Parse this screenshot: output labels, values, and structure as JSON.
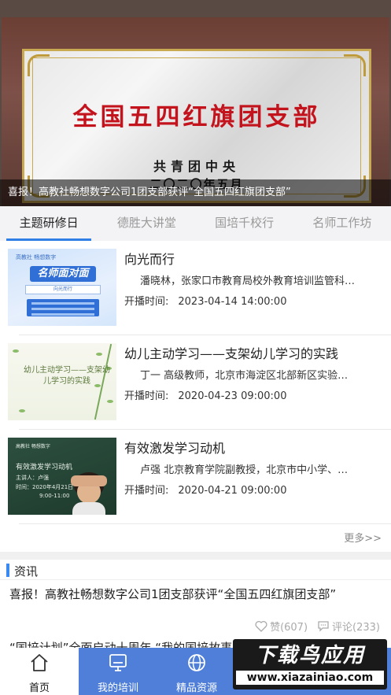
{
  "banner": {
    "plaque_title": "全国五四红旗团支部",
    "plaque_org": "共青团中央",
    "plaque_date": "二〇二〇年五月",
    "caption": "喜报！高教社畅想数字公司1团支部获评“全国五四红旗团支部”"
  },
  "tabs": [
    {
      "label": "主题研修日",
      "active": true
    },
    {
      "label": "德胜大讲堂",
      "active": false
    },
    {
      "label": "国培千校行",
      "active": false
    },
    {
      "label": "名师工作坊",
      "active": false
    }
  ],
  "courses": [
    {
      "title": "向光而行",
      "desc": "潘晓林，张家口市教育局校外教育培训监管科…",
      "time_label": "开播时间:",
      "time": "2023-04-14 14:00:00",
      "thumb": {
        "logo": "高教社 畅想数字",
        "headline": "名师面对面",
        "box": "向光而行"
      }
    },
    {
      "title": "幼儿主动学习——支架幼儿学习的实践",
      "desc": "丁一  高级教师，北京市海淀区北部新区实验…",
      "time_label": "开播时间:",
      "time": "2020-04-23 09:00:00",
      "thumb": {
        "text": "幼儿主动学习——支架幼儿学习的实践"
      }
    },
    {
      "title": "有效激发学习动机",
      "desc": "卢强 北京教育学院副教授，北京市中小学、…",
      "time_label": "开播时间:",
      "time": "2020-04-21 09:00:00",
      "thumb": {
        "logo": "高教社 畅想数字",
        "t1": "有效激发学习动机",
        "t2": "主讲人：卢强",
        "t3": "时间：2020年4月21日",
        "t4": "9:00-11:00"
      }
    }
  ],
  "more_label": "更多>>",
  "news": {
    "section_label": "资讯",
    "items": [
      {
        "title": "喜报！高教社畅想数字公司1团支部获评“全国五四红旗团支部”",
        "likes": "赞(607)",
        "comments": "评论(233)"
      },
      {
        "title": "“国培计划”全面启动十周年 “我的国培故事”征文活动通知"
      }
    ]
  },
  "bottom_nav": [
    {
      "label": "首页",
      "icon": "home-icon",
      "active": true
    },
    {
      "label": "我的培训",
      "icon": "monitor-icon",
      "active": false
    },
    {
      "label": "精品资源",
      "icon": "globe-icon",
      "active": false
    }
  ],
  "watermark": {
    "top": "下载鸟应用",
    "bottom": "www.xiazainiao.com"
  },
  "colors": {
    "accent": "#2f7fe6",
    "nav_bg": "#4f7fd8",
    "plaque_red": "#c3141e"
  }
}
